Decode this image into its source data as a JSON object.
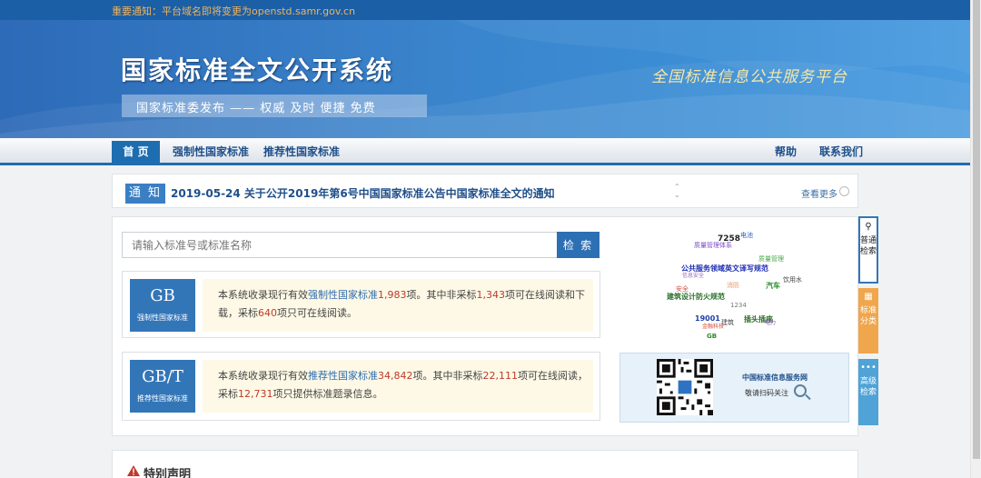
{
  "notice_bar": {
    "text": "重要通知：平台域名即将变更为openstd.samr.gov.cn"
  },
  "banner": {
    "title": "国家标准全文公开系统",
    "slogan": "国家标准委发布 —— 权威 及时 便捷 免费",
    "platform": "全国标准信息公共服务平台"
  },
  "nav": {
    "home": "首 页",
    "mandatory": "强制性国家标准",
    "recommended": "推荐性国家标准",
    "help": "帮助",
    "contact": "联系我们"
  },
  "notice": {
    "tag": "通 知",
    "title": "2019-05-24  关于公开2019年第6号中国国家标准公告中国家标准全文的通知",
    "more": "查看更多"
  },
  "search": {
    "placeholder": "请输入标准号或标准名称",
    "button": "检 索"
  },
  "gb": {
    "code": "GB",
    "name": "强制性国家标准",
    "t1": "本系统收录现行有效",
    "link": "强制性国家标准",
    "n1": "1,983",
    "t2": "项。其中非采标",
    "n2": "1,343",
    "t3": "项可在线阅读和下载，采标",
    "n3": "640",
    "t4": "项只可在线阅读。"
  },
  "gbt": {
    "code": "GB/T",
    "name": "推荐性国家标准",
    "t1": "本系统收录现行有效",
    "link": "推荐性国家标准",
    "n1": "34,842",
    "t2": "项。其中非采标",
    "n2": "22,111",
    "t3": "项可在线阅读，采标",
    "n3": "12,731",
    "t4": "项只提供标准题录信息。"
  },
  "tag_cloud": [
    {
      "text": "7258",
      "color": "#222"
    },
    {
      "text": "电池",
      "color": "#2a5fbf"
    },
    {
      "text": "质量管理体系",
      "color": "#7b49c7"
    },
    {
      "text": "质量管理",
      "color": "#4aa84a"
    },
    {
      "text": "公共服务领域英文译写规范",
      "color": "#1f2fb3"
    },
    {
      "text": "饮用水",
      "color": "#444"
    },
    {
      "text": "安全",
      "color": "#d24d3a"
    },
    {
      "text": "消防",
      "color": "#e39a6b"
    },
    {
      "text": "汽车",
      "color": "#2a8f2a"
    },
    {
      "text": "信息安全",
      "color": "#9c66c4"
    },
    {
      "text": "建筑设计防火规范",
      "color": "#2a6f2a"
    },
    {
      "text": "1234",
      "color": "#777"
    },
    {
      "text": "19001",
      "color": "#1f3fa8"
    },
    {
      "text": "插头插座",
      "color": "#2a6f2a"
    },
    {
      "text": "建筑",
      "color": "#444"
    },
    {
      "text": "金融科技",
      "color": "#d24d3a"
    },
    {
      "text": "电力",
      "color": "#8b45b8"
    },
    {
      "text": "GB",
      "color": "#2a8f2a"
    }
  ],
  "qr": {
    "title": "中国标准信息服务网",
    "subtitle": "敬请扫码关注"
  },
  "side_tabs": {
    "basic": "普通检索",
    "category": "标准分类",
    "advanced": "高级检索"
  },
  "declaration": {
    "title": "特别声明"
  }
}
